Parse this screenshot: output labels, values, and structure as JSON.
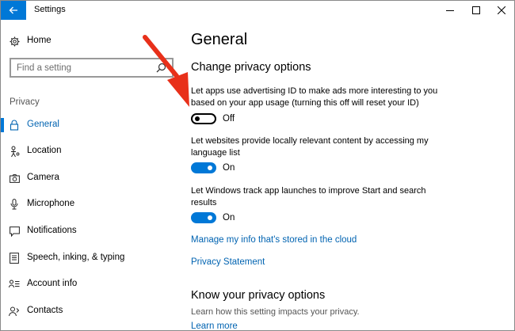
{
  "window": {
    "title": "Settings",
    "accent": "#0078d7",
    "link_color": "#0063b1",
    "annotation_color": "#e8301a"
  },
  "sidebar": {
    "home_label": "Home",
    "search_placeholder": "Find a setting",
    "section_label": "Privacy",
    "items": [
      {
        "label": "General",
        "icon": "lock-icon",
        "active": true
      },
      {
        "label": "Location",
        "icon": "location-person-icon",
        "active": false
      },
      {
        "label": "Camera",
        "icon": "camera-icon",
        "active": false
      },
      {
        "label": "Microphone",
        "icon": "microphone-icon",
        "active": false
      },
      {
        "label": "Notifications",
        "icon": "notification-icon",
        "active": false
      },
      {
        "label": "Speech, inking, & typing",
        "icon": "speech-document-icon",
        "active": false
      },
      {
        "label": "Account info",
        "icon": "account-info-icon",
        "active": false
      },
      {
        "label": "Contacts",
        "icon": "contacts-icon",
        "active": false
      }
    ]
  },
  "main": {
    "title": "General",
    "section_heading": "Change privacy options",
    "options": [
      {
        "description": "Let apps use advertising ID to make ads more interesting to you based on your app usage (turning this off will reset your ID)",
        "state": "Off",
        "on": false
      },
      {
        "description": "Let websites provide locally relevant content by accessing my language list",
        "state": "On",
        "on": true
      },
      {
        "description": "Let Windows track app launches to improve Start and search results",
        "state": "On",
        "on": true
      }
    ],
    "manage_link": "Manage my info that's stored in the cloud",
    "privacy_statement_link": "Privacy Statement",
    "know_heading": "Know your privacy options",
    "know_description": "Learn how this setting impacts your privacy.",
    "learn_more_link": "Learn more"
  }
}
